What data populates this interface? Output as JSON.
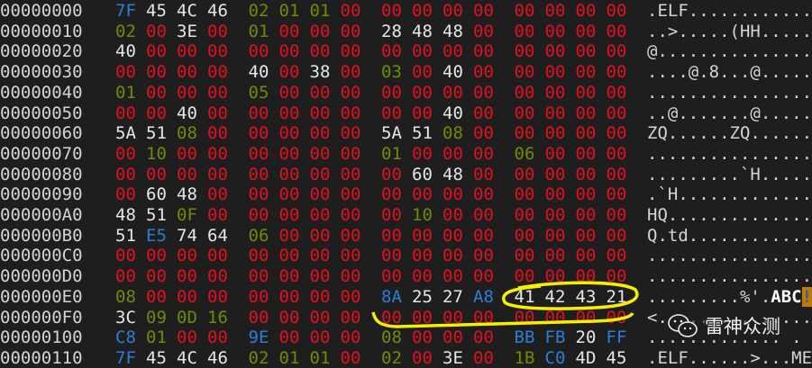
{
  "colors": {
    "zero": "#e0101e",
    "printable": "#e6e6e6",
    "control": "#6f8c00",
    "high": "#2a7fd4",
    "annotation": "#f5f000"
  },
  "rows": [
    {
      "offset": "00000000",
      "bytes": [
        "7F",
        "45",
        "4C",
        "46",
        "02",
        "01",
        "01",
        "00",
        "00",
        "00",
        "00",
        "00",
        "00",
        "00",
        "00",
        "00"
      ],
      "ascii": ".ELF............"
    },
    {
      "offset": "00000010",
      "bytes": [
        "02",
        "00",
        "3E",
        "00",
        "01",
        "00",
        "00",
        "00",
        "28",
        "48",
        "48",
        "00",
        "00",
        "00",
        "00",
        "00"
      ],
      "ascii": "..>.....(HH....."
    },
    {
      "offset": "00000020",
      "bytes": [
        "40",
        "00",
        "00",
        "00",
        "00",
        "00",
        "00",
        "00",
        "00",
        "00",
        "00",
        "00",
        "00",
        "00",
        "00",
        "00"
      ],
      "ascii": "@..............."
    },
    {
      "offset": "00000030",
      "bytes": [
        "00",
        "00",
        "00",
        "00",
        "40",
        "00",
        "38",
        "00",
        "03",
        "00",
        "40",
        "00",
        "00",
        "00",
        "00",
        "00"
      ],
      "ascii": "....@.8...@....."
    },
    {
      "offset": "00000040",
      "bytes": [
        "01",
        "00",
        "00",
        "00",
        "05",
        "00",
        "00",
        "00",
        "00",
        "00",
        "00",
        "00",
        "00",
        "00",
        "00",
        "00"
      ],
      "ascii": "................"
    },
    {
      "offset": "00000050",
      "bytes": [
        "00",
        "00",
        "40",
        "00",
        "00",
        "00",
        "00",
        "00",
        "00",
        "00",
        "40",
        "00",
        "00",
        "00",
        "00",
        "00"
      ],
      "ascii": "..@.......@....."
    },
    {
      "offset": "00000060",
      "bytes": [
        "5A",
        "51",
        "08",
        "00",
        "00",
        "00",
        "00",
        "00",
        "5A",
        "51",
        "08",
        "00",
        "00",
        "00",
        "00",
        "00"
      ],
      "ascii": "ZQ......ZQ......"
    },
    {
      "offset": "00000070",
      "bytes": [
        "00",
        "10",
        "00",
        "00",
        "00",
        "00",
        "00",
        "00",
        "01",
        "00",
        "00",
        "00",
        "06",
        "00",
        "00",
        "00"
      ],
      "ascii": "................"
    },
    {
      "offset": "00000080",
      "bytes": [
        "00",
        "00",
        "00",
        "00",
        "00",
        "00",
        "00",
        "00",
        "00",
        "60",
        "48",
        "00",
        "00",
        "00",
        "00",
        "00"
      ],
      "ascii": ".........`H....."
    },
    {
      "offset": "00000090",
      "bytes": [
        "00",
        "60",
        "48",
        "00",
        "00",
        "00",
        "00",
        "00",
        "00",
        "00",
        "00",
        "00",
        "00",
        "00",
        "00",
        "00"
      ],
      "ascii": ".`H............."
    },
    {
      "offset": "000000A0",
      "bytes": [
        "48",
        "51",
        "0F",
        "00",
        "00",
        "00",
        "00",
        "00",
        "00",
        "10",
        "00",
        "00",
        "00",
        "00",
        "00",
        "00"
      ],
      "ascii": "HQ.............."
    },
    {
      "offset": "000000B0",
      "bytes": [
        "51",
        "E5",
        "74",
        "64",
        "06",
        "00",
        "00",
        "00",
        "00",
        "00",
        "00",
        "00",
        "00",
        "00",
        "00",
        "00"
      ],
      "ascii": "Q.td............"
    },
    {
      "offset": "000000C0",
      "bytes": [
        "00",
        "00",
        "00",
        "00",
        "00",
        "00",
        "00",
        "00",
        "00",
        "00",
        "00",
        "00",
        "00",
        "00",
        "00",
        "00"
      ],
      "ascii": "................"
    },
    {
      "offset": "000000D0",
      "bytes": [
        "00",
        "00",
        "00",
        "00",
        "00",
        "00",
        "00",
        "00",
        "00",
        "00",
        "00",
        "00",
        "00",
        "00",
        "00",
        "00"
      ],
      "ascii": "................"
    },
    {
      "offset": "000000E0",
      "bytes": [
        "08",
        "00",
        "00",
        "00",
        "00",
        "00",
        "00",
        "00",
        "8A",
        "25",
        "27",
        "A8",
        "41",
        "42",
        "43",
        "21"
      ],
      "ascii": ".........%'.ABC!"
    },
    {
      "offset": "000000F0",
      "bytes": [
        "3C",
        "09",
        "0D",
        "16",
        "00",
        "00",
        "00",
        "00",
        "00",
        "00",
        "00",
        "00",
        "00",
        "00",
        "00",
        "00"
      ],
      "ascii": "<..............."
    },
    {
      "offset": "00000100",
      "bytes": [
        "C8",
        "01",
        "00",
        "00",
        "9E",
        "00",
        "00",
        "00",
        "08",
        "00",
        "00",
        "00",
        "BB",
        "FB",
        "20",
        "FF"
      ],
      "ascii": "............. ."
    },
    {
      "offset": "00000110",
      "bytes": [
        "7F",
        "45",
        "4C",
        "46",
        "02",
        "01",
        "01",
        "00",
        "02",
        "00",
        "3E",
        "00",
        "1B",
        "C0",
        "4D",
        "45"
      ],
      "ascii": ".ELF......>...ME"
    }
  ],
  "cursor": {
    "row": 14,
    "column": 15
  },
  "watermark": {
    "icon": "wechat-icon",
    "text": "雷神众测"
  }
}
